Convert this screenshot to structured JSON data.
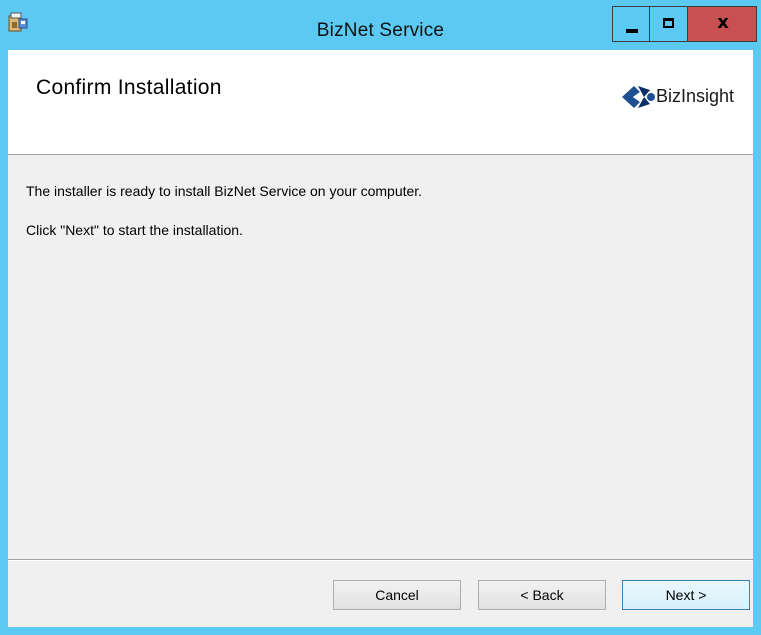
{
  "window": {
    "title": "BizNet Service",
    "controls": {
      "minimize_icon": "minimize-icon",
      "maximize_icon": "maximize-icon",
      "close_label": "x"
    }
  },
  "header": {
    "title": "Confirm Installation",
    "logo_text": "BizInsight",
    "logo_icon": "bizinsight-logo-icon"
  },
  "content": {
    "line1": "The installer is ready to install BizNet Service on your computer.",
    "line2": "Click \"Next\" to start the installation."
  },
  "buttons": {
    "cancel": "Cancel",
    "back": "< Back",
    "next": "Next >"
  },
  "colors": {
    "titlebar": "#5bc9f1",
    "close_button": "#c75050",
    "dialog_background": "#f0f0f0"
  }
}
